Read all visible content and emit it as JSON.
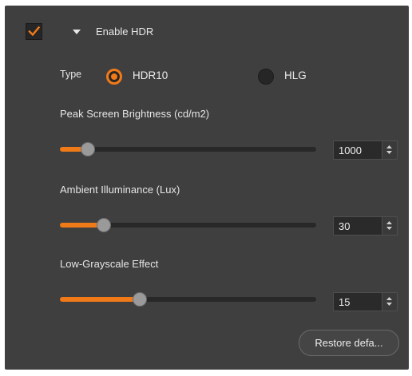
{
  "header": {
    "enabled": true,
    "expanded": true,
    "title": "Enable HDR"
  },
  "type": {
    "label": "Type",
    "options": [
      {
        "label": "HDR10",
        "selected": true
      },
      {
        "label": "HLG",
        "selected": false
      }
    ]
  },
  "settings": [
    {
      "label": "Peak Screen Brightness (cd/m2)",
      "value": "1000",
      "slider_fraction": 0.11
    },
    {
      "label": "Ambient Illuminance (Lux)",
      "value": "30",
      "slider_fraction": 0.17
    },
    {
      "label": "Low-Grayscale Effect",
      "value": "15",
      "slider_fraction": 0.31
    }
  ],
  "restore_button_label": "Restore defa...",
  "colors": {
    "accent": "#f07a18",
    "panel_background": "#3f3f3f",
    "track": "#282828"
  },
  "icons": [
    "check-icon",
    "caret-down-icon",
    "spin-arrows-icon"
  ]
}
